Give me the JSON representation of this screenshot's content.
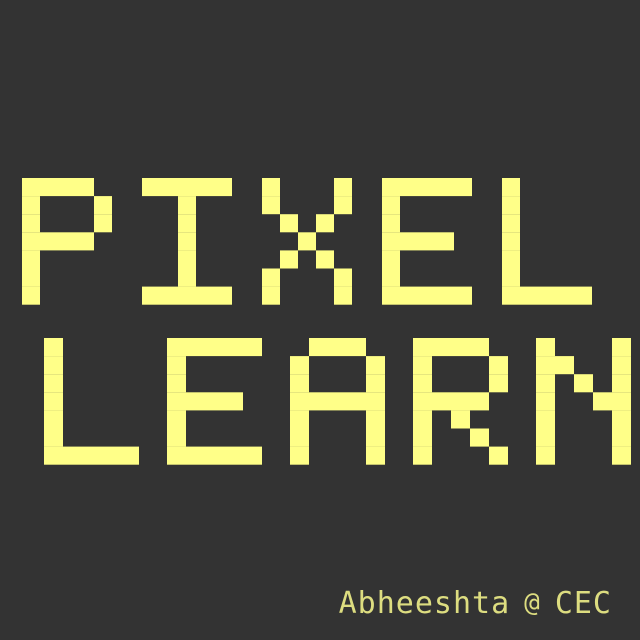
{
  "title": {
    "line1": "PIXEL",
    "line2": "LEARN"
  },
  "credit": {
    "author": "Abheeshta",
    "separator": "@",
    "org": "CEC"
  },
  "colors": {
    "background": "#333333",
    "title_text": "#ffff88",
    "credit_text": "#dddd80"
  }
}
